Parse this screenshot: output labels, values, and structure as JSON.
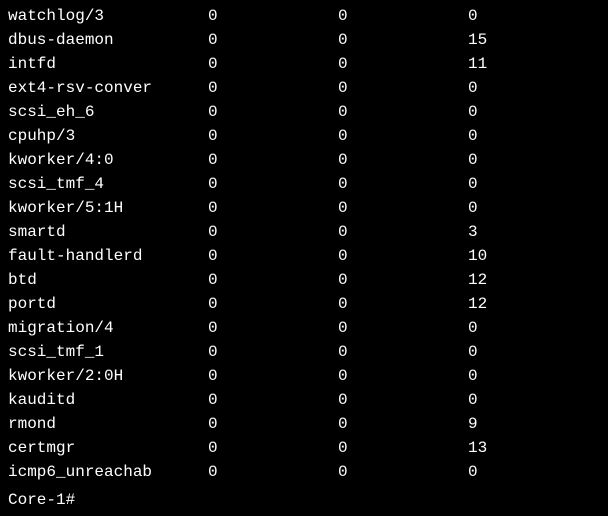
{
  "processes": [
    {
      "name": "watchlog/3",
      "c1": "0",
      "c2": "0",
      "c3": "0"
    },
    {
      "name": "dbus-daemon",
      "c1": "0",
      "c2": "0",
      "c3": "15"
    },
    {
      "name": "intfd",
      "c1": "0",
      "c2": "0",
      "c3": "11"
    },
    {
      "name": "ext4-rsv-conver",
      "c1": "0",
      "c2": "0",
      "c3": "0"
    },
    {
      "name": "scsi_eh_6",
      "c1": "0",
      "c2": "0",
      "c3": "0"
    },
    {
      "name": "cpuhp/3",
      "c1": "0",
      "c2": "0",
      "c3": "0"
    },
    {
      "name": "kworker/4:0",
      "c1": "0",
      "c2": "0",
      "c3": "0"
    },
    {
      "name": "scsi_tmf_4",
      "c1": "0",
      "c2": "0",
      "c3": "0"
    },
    {
      "name": "kworker/5:1H",
      "c1": "0",
      "c2": "0",
      "c3": "0"
    },
    {
      "name": "smartd",
      "c1": "0",
      "c2": "0",
      "c3": "3"
    },
    {
      "name": "fault-handlerd",
      "c1": "0",
      "c2": "0",
      "c3": "10"
    },
    {
      "name": "btd",
      "c1": "0",
      "c2": "0",
      "c3": "12"
    },
    {
      "name": "portd",
      "c1": "0",
      "c2": "0",
      "c3": "12"
    },
    {
      "name": "migration/4",
      "c1": "0",
      "c2": "0",
      "c3": "0"
    },
    {
      "name": "scsi_tmf_1",
      "c1": "0",
      "c2": "0",
      "c3": "0"
    },
    {
      "name": "kworker/2:0H",
      "c1": "0",
      "c2": "0",
      "c3": "0"
    },
    {
      "name": "kauditd",
      "c1": "0",
      "c2": "0",
      "c3": "0"
    },
    {
      "name": "rmond",
      "c1": "0",
      "c2": "0",
      "c3": "9"
    },
    {
      "name": "certmgr",
      "c1": "0",
      "c2": "0",
      "c3": "13"
    },
    {
      "name": "icmp6_unreachab",
      "c1": "0",
      "c2": "0",
      "c3": "0"
    }
  ],
  "prompt": "Core-1#"
}
